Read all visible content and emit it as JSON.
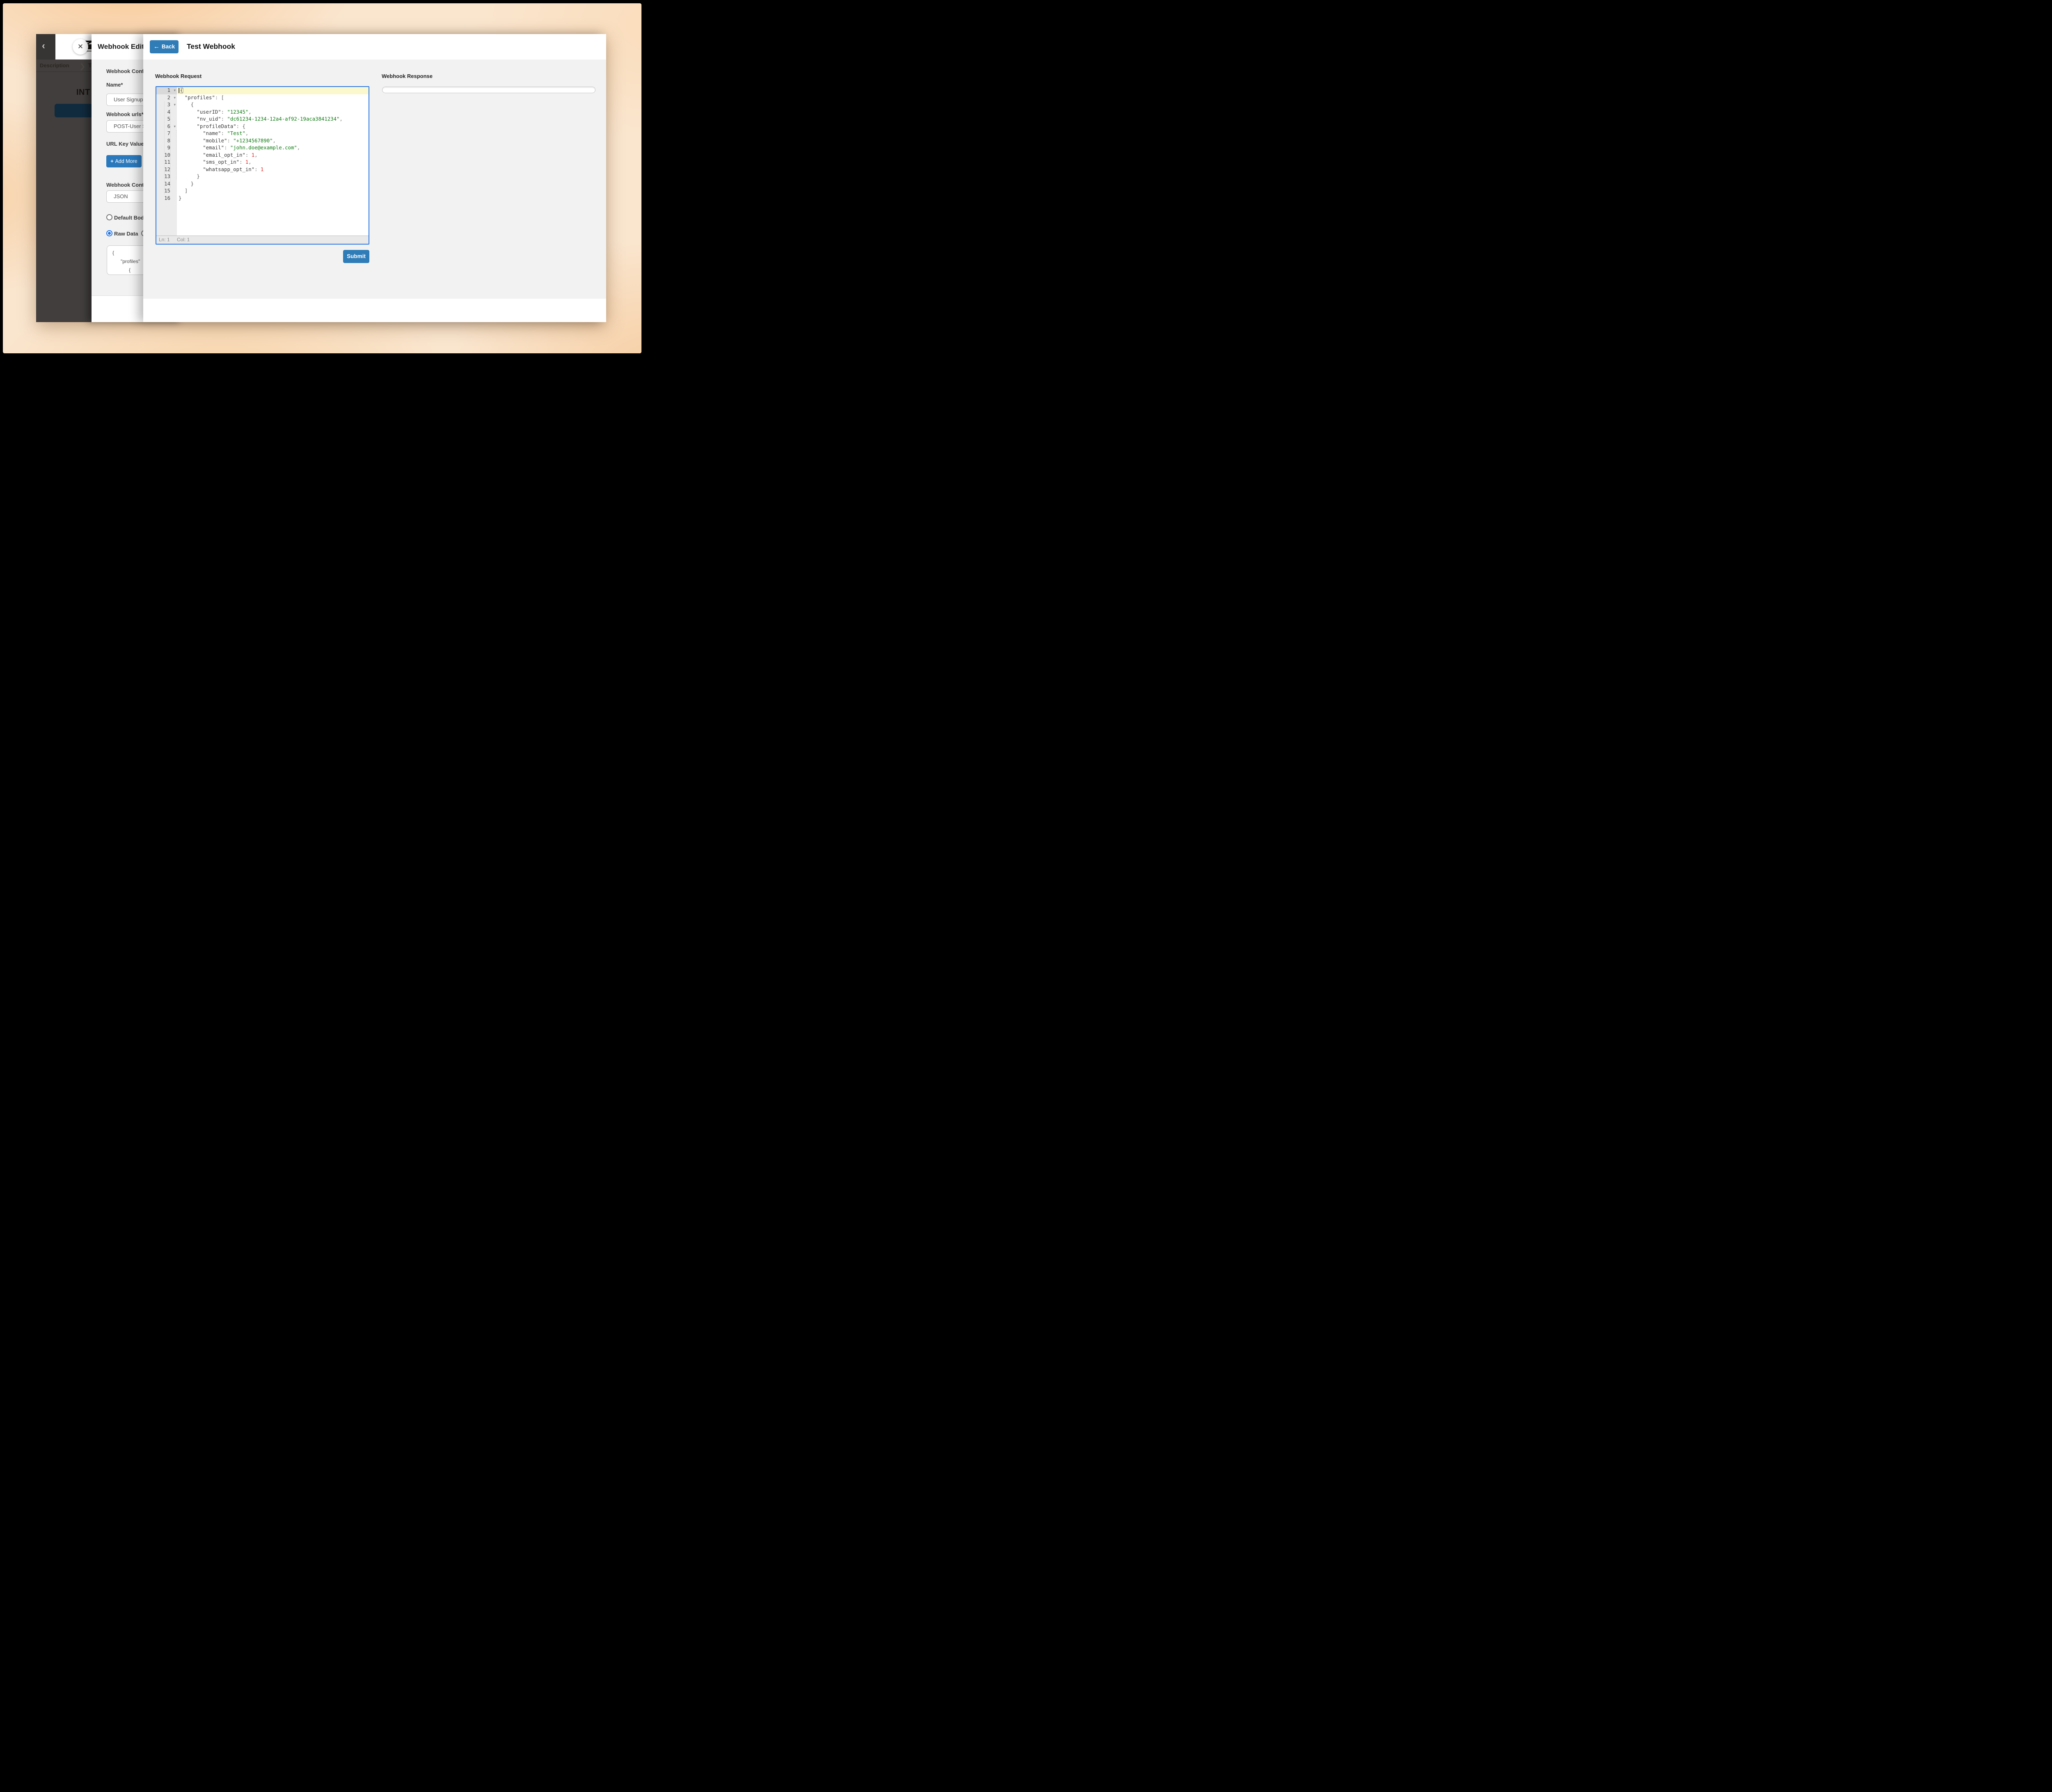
{
  "colors": {
    "accent_blue": "#2f7cb7",
    "editor_focus_border": "#2b78e4",
    "navy_button": "#102a3e",
    "string_green": "#0f7d12",
    "number_red": "#e02020",
    "radio_selected_blue": "#1a73e8",
    "active_line_yellow": "#fcf8cd",
    "dark_page_bg": "#413e3d",
    "wallpaper_peach": "#fae6cf"
  },
  "icons": {
    "back_chevron": "‹",
    "close": "✕",
    "tab_separator": "›",
    "back_arrow": "←",
    "fold_caret": "▾",
    "add_plus": "+"
  },
  "dark_page": {
    "tabs": [
      {
        "label": "Description"
      },
      {
        "label": "T"
      }
    ],
    "heading_partial": "INT"
  },
  "drawer": {
    "title": "Webhook Edit",
    "labels": {
      "section": "Webhook Conf",
      "name": "Name*",
      "urls": "Webhook urls*",
      "url_key_value": "URL Key Value",
      "content_type": "Webhook Cont"
    },
    "fields": {
      "name_value": "User Signup W",
      "urls_value": "POST-User S",
      "content_type_value": "JSON"
    },
    "buttons": {
      "add_more": "Add More"
    },
    "radios": [
      {
        "label": "Default Body",
        "selected": false
      },
      {
        "label": "Raw Data",
        "selected": true
      }
    ],
    "preview_lines": [
      {
        "indent": 0,
        "text": "{"
      },
      {
        "indent": 1,
        "text": "\"profiles\""
      },
      {
        "indent": 2,
        "text": "{"
      },
      {
        "indent": 3,
        "text": "\""
      }
    ]
  },
  "test": {
    "back": "Back",
    "title": "Test Webhook",
    "request_label": "Webhook Request",
    "response_label": "Webhook Response",
    "submit": "Submit",
    "status": {
      "ln": "Ln: 1",
      "col": "Col: 1"
    },
    "editor": {
      "lines": [
        {
          "num": 1,
          "fold": true,
          "active": true,
          "parts": [
            [
              "cursor",
              ""
            ],
            [
              "brace match",
              "{"
            ]
          ]
        },
        {
          "num": 2,
          "fold": true,
          "parts": [
            [
              "pun",
              "  "
            ],
            [
              "key",
              "\"profiles\""
            ],
            [
              "pun",
              ": "
            ],
            [
              "brace",
              "["
            ]
          ]
        },
        {
          "num": 3,
          "fold": true,
          "parts": [
            [
              "pun",
              "    "
            ],
            [
              "brace",
              "{"
            ]
          ]
        },
        {
          "num": 4,
          "parts": [
            [
              "pun",
              "      "
            ],
            [
              "key",
              "\"userID\""
            ],
            [
              "pun",
              ": "
            ],
            [
              "str",
              "\"12345\""
            ],
            [
              "pun",
              ","
            ]
          ]
        },
        {
          "num": 5,
          "parts": [
            [
              "pun",
              "      "
            ],
            [
              "key",
              "\"nv_uid\""
            ],
            [
              "pun",
              ": "
            ],
            [
              "str",
              "\"dc61234-1234-12a4-af92-19aca3841234\""
            ],
            [
              "pun",
              ","
            ]
          ]
        },
        {
          "num": 6,
          "fold": true,
          "parts": [
            [
              "pun",
              "      "
            ],
            [
              "key",
              "\"profileData\""
            ],
            [
              "pun",
              ": "
            ],
            [
              "brace",
              "{"
            ]
          ]
        },
        {
          "num": 7,
          "parts": [
            [
              "pun",
              "        "
            ],
            [
              "key",
              "\"name\""
            ],
            [
              "pun",
              ": "
            ],
            [
              "str",
              "\"Test\""
            ],
            [
              "pun",
              ","
            ]
          ]
        },
        {
          "num": 8,
          "parts": [
            [
              "pun",
              "        "
            ],
            [
              "key",
              "\"mobile\""
            ],
            [
              "pun",
              ": "
            ],
            [
              "str",
              "\"+1234567890\""
            ],
            [
              "pun",
              ","
            ]
          ]
        },
        {
          "num": 9,
          "parts": [
            [
              "pun",
              "        "
            ],
            [
              "key",
              "\"email\""
            ],
            [
              "pun",
              ": "
            ],
            [
              "str",
              "\"john.doe@example.com\""
            ],
            [
              "pun",
              ","
            ]
          ]
        },
        {
          "num": 10,
          "parts": [
            [
              "pun",
              "        "
            ],
            [
              "key",
              "\"email_opt_in\""
            ],
            [
              "pun",
              ": "
            ],
            [
              "num",
              "1"
            ],
            [
              "pun",
              ","
            ]
          ]
        },
        {
          "num": 11,
          "parts": [
            [
              "pun",
              "        "
            ],
            [
              "key",
              "\"sms_opt_in\""
            ],
            [
              "pun",
              ": "
            ],
            [
              "num",
              "1"
            ],
            [
              "pun",
              ","
            ]
          ]
        },
        {
          "num": 12,
          "parts": [
            [
              "pun",
              "        "
            ],
            [
              "key",
              "\"whatsapp_opt_in\""
            ],
            [
              "pun",
              ": "
            ],
            [
              "num",
              "1"
            ]
          ]
        },
        {
          "num": 13,
          "parts": [
            [
              "pun",
              "      "
            ],
            [
              "brace",
              "}"
            ]
          ]
        },
        {
          "num": 14,
          "parts": [
            [
              "pun",
              "    "
            ],
            [
              "brace",
              "}"
            ]
          ]
        },
        {
          "num": 15,
          "parts": [
            [
              "pun",
              "  "
            ],
            [
              "brace",
              "]"
            ]
          ]
        },
        {
          "num": 16,
          "parts": [
            [
              "brace",
              "}"
            ]
          ]
        }
      ]
    }
  }
}
